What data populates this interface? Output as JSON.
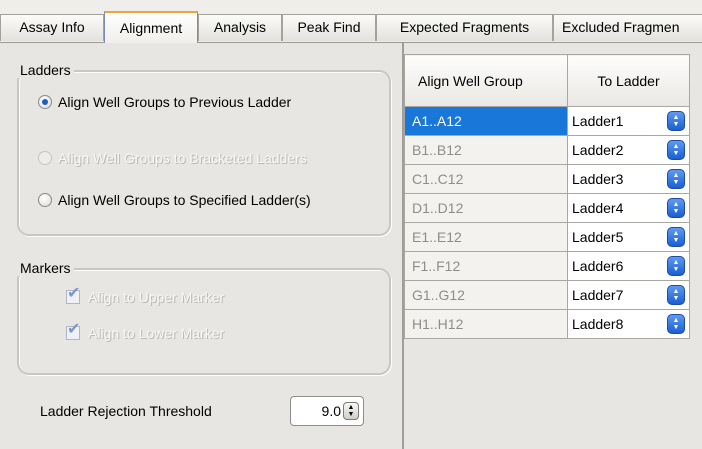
{
  "tabs": [
    {
      "label": "Assay Info",
      "active": false
    },
    {
      "label": "Alignment",
      "active": true
    },
    {
      "label": "Analysis",
      "active": false
    },
    {
      "label": "Peak Find",
      "active": false
    },
    {
      "label": "Expected Fragments",
      "active": false
    },
    {
      "label": "Excluded Fragmen",
      "active": false
    }
  ],
  "ladders": {
    "label": "Ladders",
    "options": [
      {
        "label": "Align Well Groups to Previous Ladder",
        "selected": true,
        "enabled": true
      },
      {
        "label": "Align Well Groups to Bracketed Ladders",
        "selected": false,
        "enabled": false
      },
      {
        "label": "Align Well Groups to Specified Ladder(s)",
        "selected": false,
        "enabled": true
      }
    ]
  },
  "markers": {
    "label": "Markers",
    "options": [
      {
        "label": "Align to Upper Marker",
        "checked": true,
        "enabled": false
      },
      {
        "label": "Align to Lower Marker",
        "checked": true,
        "enabled": false
      }
    ]
  },
  "threshold": {
    "label": "Ladder Rejection Threshold",
    "value": "9.0"
  },
  "grid": {
    "headers": {
      "group": "Align Well Group",
      "ladder": "To Ladder"
    },
    "rows": [
      {
        "group": "A1..A12",
        "ladder": "Ladder1",
        "selected": true
      },
      {
        "group": "B1..B12",
        "ladder": "Ladder2",
        "selected": false
      },
      {
        "group": "C1..C12",
        "ladder": "Ladder3",
        "selected": false
      },
      {
        "group": "D1..D12",
        "ladder": "Ladder4",
        "selected": false
      },
      {
        "group": "E1..E12",
        "ladder": "Ladder5",
        "selected": false
      },
      {
        "group": "F1..F12",
        "ladder": "Ladder6",
        "selected": false
      },
      {
        "group": "G1..G12",
        "ladder": "Ladder7",
        "selected": false
      },
      {
        "group": "H1..H12",
        "ladder": "Ladder8",
        "selected": false
      }
    ]
  },
  "icons": {
    "checkmark": "checkmark-icon",
    "spin_up": "spin-up-arrow-icon",
    "spin_down": "spin-down-arrow-icon"
  },
  "colors": {
    "selection": "#1877d9",
    "active_tab_accent": "#f1a43c",
    "combo_button": "#1a5fd3"
  }
}
